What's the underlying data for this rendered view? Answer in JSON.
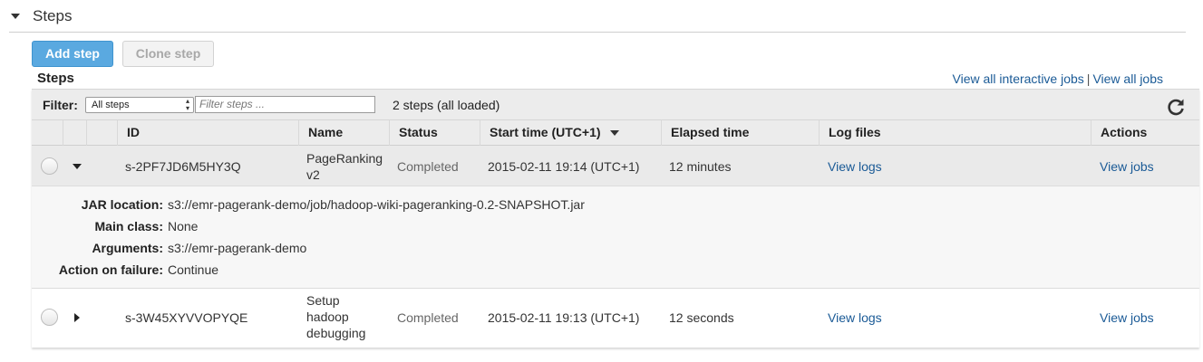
{
  "section": {
    "title": "Steps"
  },
  "toolbar": {
    "add_label": "Add step",
    "clone_label": "Clone step"
  },
  "steps_label": "Steps",
  "links": {
    "interactive": "View all interactive jobs",
    "separator": "|",
    "all": "View all jobs"
  },
  "filter": {
    "label": "Filter:",
    "selected": "All steps",
    "placeholder": "Filter steps ...",
    "count_text": "2 steps (all loaded)"
  },
  "columns": {
    "id": "ID",
    "name": "Name",
    "status": "Status",
    "start": "Start time (UTC+1)",
    "elapsed": "Elapsed time",
    "logs": "Log files",
    "actions": "Actions"
  },
  "rows": [
    {
      "id": "s-2PF7JD6M5HY3Q",
      "name_lines": [
        "PageRanking",
        "v2"
      ],
      "status": "Completed",
      "start": "2015-02-11 19:14 (UTC+1)",
      "elapsed": "12 minutes",
      "logs": "View logs",
      "actions": "View jobs",
      "expanded": true
    },
    {
      "id": "s-3W45XYVVOPYQE",
      "name_lines": [
        "Setup",
        "hadoop",
        "debugging"
      ],
      "status": "Completed",
      "start": "2015-02-11 19:13 (UTC+1)",
      "elapsed": "12 seconds",
      "logs": "View logs",
      "actions": "View jobs",
      "expanded": false
    }
  ],
  "details": {
    "jar_label": "JAR location:",
    "jar_value": "s3://emr-pagerank-demo/job/hadoop-wiki-pageranking-0.2-SNAPSHOT.jar",
    "main_label": "Main class:",
    "main_value": "None",
    "args_label": "Arguments:",
    "args_value": "s3://emr-pagerank-demo",
    "failure_label": "Action on failure:",
    "failure_value": "Continue"
  },
  "colors": {
    "link": "#1a5a96",
    "primary_button": "#5aa9e0",
    "header_bg": "#ececec"
  },
  "icons": {
    "refresh": "refresh-icon",
    "caret": "caret-down-icon"
  }
}
